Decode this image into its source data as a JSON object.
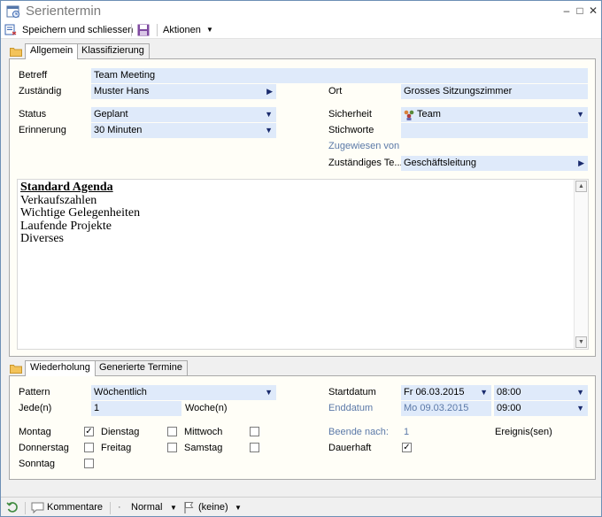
{
  "window": {
    "title": "Serientermin"
  },
  "toolbar": {
    "save_close": "Speichern und schliessen",
    "actions": "Aktionen"
  },
  "tabs_top": [
    "Allgemein",
    "Klassifizierung"
  ],
  "general": {
    "betreff_label": "Betreff",
    "betreff_value": "Team Meeting",
    "zustaendig_label": "Zuständig",
    "zustaendig_value": "Muster Hans",
    "ort_label": "Ort",
    "ort_value": "Grosses Sitzungszimmer",
    "status_label": "Status",
    "status_value": "Geplant",
    "sicherheit_label": "Sicherheit",
    "sicherheit_value": "Team",
    "erinnerung_label": "Erinnerung",
    "erinnerung_value": "30 Minuten",
    "stichworte_label": "Stichworte",
    "stichworte_value": "",
    "zugewiesen_label": "Zugewiesen von",
    "team_label": "Zuständiges Te...",
    "team_value": "Geschäftsleitung"
  },
  "memo": {
    "heading": "Standard Agenda",
    "lines": [
      "Verkaufszahlen",
      "Wichtige Gelegenheiten",
      "Laufende Projekte",
      "Diverses"
    ]
  },
  "tabs_bottom": [
    "Wiederholung",
    "Generierte Termine"
  ],
  "recurrence": {
    "pattern_label": "Pattern",
    "pattern_value": "Wöchentlich",
    "every_label": "Jede(n)",
    "every_value": "1",
    "every_unit": "Woche(n)",
    "start_label": "Startdatum",
    "start_date": "Fr 06.03.2015",
    "start_time": "08:00",
    "end_label": "Enddatum",
    "end_date": "Mo 09.03.2015",
    "end_time": "09:00",
    "days": [
      {
        "label": "Montag",
        "checked": true
      },
      {
        "label": "Dienstag",
        "checked": false
      },
      {
        "label": "Mittwoch",
        "checked": false
      },
      {
        "label": "Donnerstag",
        "checked": false
      },
      {
        "label": "Freitag",
        "checked": false
      },
      {
        "label": "Samstag",
        "checked": false
      },
      {
        "label": "Sonntag",
        "checked": false
      }
    ],
    "end_after_label": "Beende nach:",
    "end_after_value": "1",
    "end_after_unit": "Ereignis(sen)",
    "permanent_label": "Dauerhaft",
    "permanent_checked": true
  },
  "statusbar": {
    "comments": "Kommentare",
    "priority": "Normal",
    "flag": "(keine)"
  }
}
